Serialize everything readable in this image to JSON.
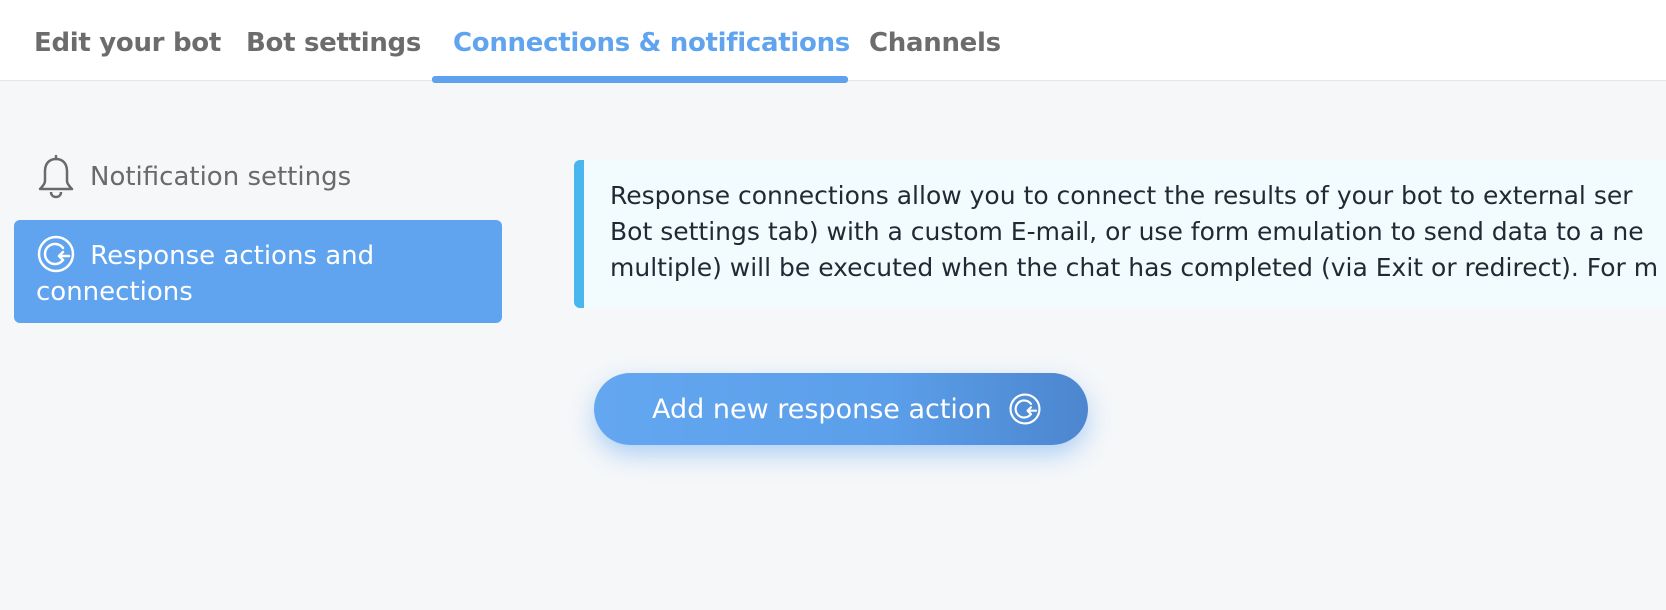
{
  "tabs": [
    {
      "label": "Edit your bot",
      "active": false
    },
    {
      "label": "Bot settings",
      "active": false
    },
    {
      "label": "Connections & notifications",
      "active": true
    },
    {
      "label": "Channels",
      "active": false
    }
  ],
  "sidebar": {
    "items": [
      {
        "label": "Notification settings",
        "icon": "bell-icon",
        "active": false
      },
      {
        "label": "Response actions and connections",
        "icon": "response-action-icon",
        "active": true
      }
    ]
  },
  "info": {
    "lines": [
      "Response connections allow you to connect the results of your bot to external ser",
      "Bot settings tab) with a custom E-mail, or use form emulation to send data to a ne",
      "multiple) will be executed when the chat has completed (via Exit or redirect). For m"
    ]
  },
  "add_button": {
    "label": "Add new response action",
    "icon": "response-action-icon"
  },
  "colors": {
    "accent": "#60a3ef",
    "info_border": "#4ab6ee",
    "info_background": "#f2fbfd",
    "page_background": "#f5f7f9"
  }
}
